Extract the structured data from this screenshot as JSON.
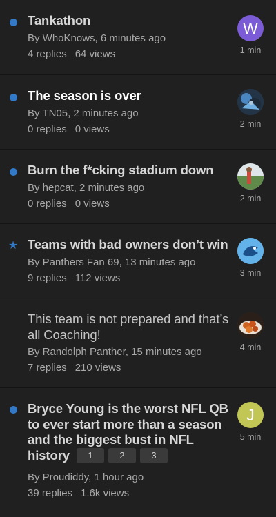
{
  "threads": [
    {
      "title": "Tankathon",
      "author_line": "By WhoKnows, 6 minutes ago",
      "replies": "4 replies",
      "views": "64 views",
      "time": "1 min",
      "avatar_letter": "W",
      "avatar_color": "#7b5bd6",
      "status": "unread"
    },
    {
      "title": "The season is over",
      "author_line": "By TN05, 2 minutes ago",
      "replies": "0 replies",
      "views": "0 views",
      "time": "2 min",
      "avatar_icon": "photo-avatar-icon",
      "status": "unread"
    },
    {
      "title": "Burn the f*cking stadium down",
      "author_line": "By hepcat, 2 minutes ago",
      "replies": "0 replies",
      "views": "0 views",
      "time": "2 min",
      "avatar_icon": "photo-avatar-icon",
      "status": "unread"
    },
    {
      "title": "Teams with bad owners don’t win",
      "author_line": "By Panthers Fan 69, 13 minutes ago",
      "replies": "9 replies",
      "views": "112 views",
      "time": "3 min",
      "avatar_icon": "bird-avatar-icon",
      "status": "starred"
    },
    {
      "title": "This team is not prepared and that’s all Coaching!",
      "author_line": "By Randolph Panther, 15 minutes ago",
      "replies": "7 replies",
      "views": "210 views",
      "time": "4 min",
      "avatar_icon": "food-avatar-icon",
      "status": "read"
    },
    {
      "title": "Bryce Young is the worst NFL QB to ever start more than a season and the biggest bust in NFL history",
      "author_line": "By Proudiddy, 1 hour ago",
      "replies": "39 replies",
      "views": "1.6k views",
      "time": "5 min",
      "avatar_letter": "J",
      "avatar_color": "#c2c655",
      "status": "unread",
      "pages": [
        "1",
        "2",
        "3"
      ]
    }
  ],
  "colors": {
    "background": "#202020",
    "unread_dot": "#3279c7",
    "title": "#d7d7d7",
    "meta": "#a8a8a8"
  }
}
